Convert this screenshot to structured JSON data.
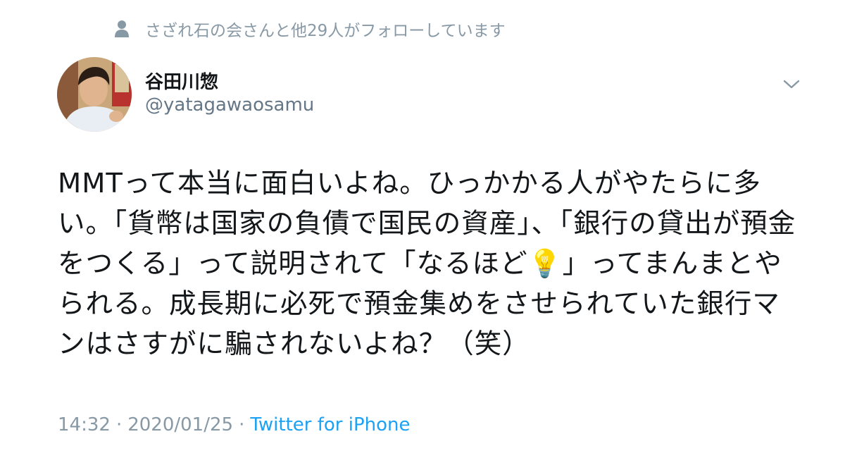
{
  "social_context": {
    "icon": "person-icon",
    "text": "さざれ石の会さんと他29人がフォローしています"
  },
  "author": {
    "name": "谷田川惣",
    "handle": "@yatagawaosamu"
  },
  "tweet": {
    "text": "MMTって本当に面白いよね。ひっかかる人がやたらに多い。「貨幣は国家の負債で国民の資産」、「銀行の貸出が預金をつくる」って説明されて「なるほど💡」ってまんまとやられる。成長期に必死で預金集めをさせられていた銀行マンはさすがに騙されないよね？（笑）",
    "time": "14:32",
    "date": "2020/01/25",
    "separator": "·",
    "source": "Twitter for iPhone"
  },
  "colors": {
    "accent": "#1da1f2",
    "secondary_text": "#8899a6",
    "primary_text": "#14171a"
  }
}
